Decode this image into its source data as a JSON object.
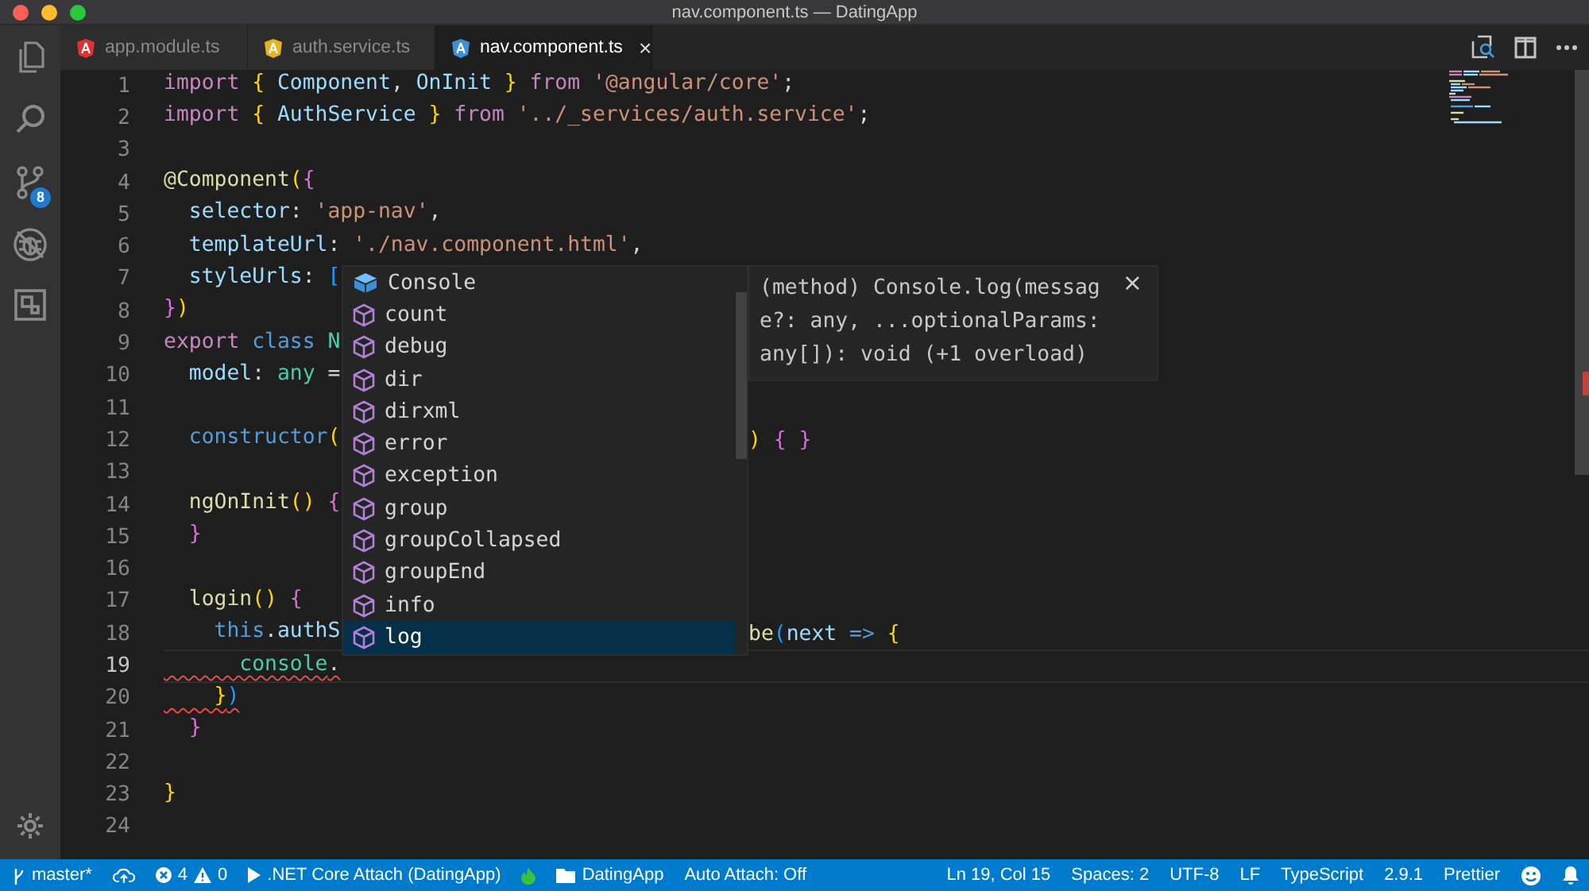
{
  "window": {
    "title": "nav.component.ts — DatingApp"
  },
  "activity_bar": {
    "source_control_badge": "8"
  },
  "tabs": [
    {
      "label": "app.module.ts",
      "color": "#dd3333",
      "selected": false
    },
    {
      "label": "auth.service.ts",
      "color": "#e8b320",
      "selected": false
    },
    {
      "label": "nav.component.ts",
      "color": "#3f8fd6",
      "selected": true,
      "close": "×"
    }
  ],
  "editor": {
    "lines": [
      {
        "number": "1",
        "current": false,
        "error": false,
        "tokens": [
          {
            "kind": "keyword",
            "text": "import "
          },
          {
            "kind": "bracket1",
            "text": "{ "
          },
          {
            "kind": "variable",
            "text": "Component"
          },
          {
            "kind": "plain",
            "text": ", "
          },
          {
            "kind": "variable",
            "text": "OnInit "
          },
          {
            "kind": "bracket1",
            "text": "} "
          },
          {
            "kind": "keyword",
            "text": "from "
          },
          {
            "kind": "string",
            "text": "'@angular/core'"
          },
          {
            "kind": "plain",
            "text": ";"
          }
        ]
      },
      {
        "number": "2",
        "current": false,
        "error": false,
        "tokens": [
          {
            "kind": "keyword",
            "text": "import "
          },
          {
            "kind": "bracket1",
            "text": "{ "
          },
          {
            "kind": "variable",
            "text": "AuthService "
          },
          {
            "kind": "bracket1",
            "text": "} "
          },
          {
            "kind": "keyword",
            "text": "from "
          },
          {
            "kind": "string",
            "text": "'../_services/auth.service'"
          },
          {
            "kind": "plain",
            "text": ";"
          }
        ]
      },
      {
        "number": "3",
        "current": false
      },
      {
        "number": "4",
        "current": false,
        "error": false,
        "tokens": [
          {
            "kind": "function",
            "text": "@Component"
          },
          {
            "kind": "bracket1",
            "text": "("
          },
          {
            "kind": "bracket2",
            "text": "{"
          }
        ]
      },
      {
        "number": "5",
        "current": false,
        "error": false,
        "tokens": [
          {
            "kind": "variable",
            "text": "  selector"
          },
          {
            "kind": "plain",
            "text": ": "
          },
          {
            "kind": "string",
            "text": "'app-nav'"
          },
          {
            "kind": "plain",
            "text": ","
          }
        ]
      },
      {
        "number": "6",
        "current": false,
        "error": false,
        "tokens": [
          {
            "kind": "variable",
            "text": "  templateUrl"
          },
          {
            "kind": "plain",
            "text": ": "
          },
          {
            "kind": "string",
            "text": "'./nav.component.html'"
          },
          {
            "kind": "plain",
            "text": ","
          }
        ]
      },
      {
        "number": "7",
        "current": false,
        "error": false,
        "tokens": [
          {
            "kind": "variable",
            "text": "  styleUrls"
          },
          {
            "kind": "plain",
            "text": ": "
          },
          {
            "kind": "bracket3",
            "text": "["
          }
        ]
      },
      {
        "number": "8",
        "current": false,
        "error": false,
        "tokens": [
          {
            "kind": "bracket2",
            "text": "}"
          },
          {
            "kind": "bracket1",
            "text": ")"
          }
        ]
      },
      {
        "number": "9",
        "current": false,
        "error": false,
        "tokens": [
          {
            "kind": "keyword",
            "text": "export "
          },
          {
            "kind": "storage",
            "text": "class "
          },
          {
            "kind": "type",
            "text": "N"
          }
        ]
      },
      {
        "number": "10",
        "current": false,
        "error": false,
        "tokens": [
          {
            "kind": "variable",
            "text": "  model"
          },
          {
            "kind": "plain",
            "text": ": "
          },
          {
            "kind": "type",
            "text": "any "
          },
          {
            "kind": "plain",
            "text": "="
          }
        ]
      },
      {
        "number": "11",
        "current": false
      },
      {
        "number": "12",
        "current": false,
        "error": false,
        "tokens": [
          {
            "kind": "storage",
            "text": "  constructor"
          },
          {
            "kind": "bracket1",
            "text": "("
          }
        ],
        "tokens_after": [
          {
            "kind": "bracket1",
            "text": ") "
          },
          {
            "kind": "bracket2",
            "text": "{ }"
          }
        ]
      },
      {
        "number": "13",
        "current": false
      },
      {
        "number": "14",
        "current": false,
        "error": false,
        "tokens": [
          {
            "kind": "function",
            "text": "  ngOnInit"
          },
          {
            "kind": "bracket1",
            "text": "() "
          },
          {
            "kind": "bracket2",
            "text": "{"
          }
        ]
      },
      {
        "number": "15",
        "current": false,
        "error": false,
        "tokens": [
          {
            "kind": "bracket2",
            "text": "  }"
          }
        ]
      },
      {
        "number": "16",
        "current": false
      },
      {
        "number": "17",
        "current": false,
        "error": false,
        "tokens": [
          {
            "kind": "function",
            "text": "  login"
          },
          {
            "kind": "bracket1",
            "text": "() "
          },
          {
            "kind": "bracket2",
            "text": "{"
          }
        ]
      },
      {
        "number": "18",
        "current": false,
        "error": false,
        "tokens": [
          {
            "kind": "storage",
            "text": "    this"
          },
          {
            "kind": "plain",
            "text": "."
          },
          {
            "kind": "variable",
            "text": "authS"
          }
        ],
        "tokens_after": [
          {
            "kind": "function",
            "text": "be"
          },
          {
            "kind": "bracket3",
            "text": "("
          },
          {
            "kind": "variable",
            "text": "next "
          },
          {
            "kind": "storage",
            "text": "=> "
          },
          {
            "kind": "bracket1",
            "text": "{"
          }
        ]
      },
      {
        "number": "19",
        "current": true,
        "error": true,
        "tokens": [
          {
            "kind": "type",
            "text": "      console"
          },
          {
            "kind": "plain",
            "text": "."
          }
        ]
      },
      {
        "number": "20",
        "current": false,
        "error": true,
        "tokens": [
          {
            "kind": "bracket1",
            "text": "    }"
          },
          {
            "kind": "bracket3",
            "text": ")"
          }
        ]
      },
      {
        "number": "21",
        "current": false,
        "error": false,
        "tokens": [
          {
            "kind": "bracket2",
            "text": "  }"
          }
        ]
      },
      {
        "number": "22",
        "current": false
      },
      {
        "number": "23",
        "current": false,
        "error": false,
        "tokens": [
          {
            "kind": "bracket1",
            "text": "}"
          }
        ]
      },
      {
        "number": "24",
        "current": false
      }
    ],
    "suggest": {
      "items": [
        {
          "label": "Console",
          "kind": "class",
          "selected": false
        },
        {
          "label": "count",
          "kind": "method",
          "selected": false
        },
        {
          "label": "debug",
          "kind": "method",
          "selected": false
        },
        {
          "label": "dir",
          "kind": "method",
          "selected": false
        },
        {
          "label": "dirxml",
          "kind": "method",
          "selected": false
        },
        {
          "label": "error",
          "kind": "method",
          "selected": false
        },
        {
          "label": "exception",
          "kind": "method",
          "selected": false
        },
        {
          "label": "group",
          "kind": "method",
          "selected": false
        },
        {
          "label": "groupCollapsed",
          "kind": "method",
          "selected": false
        },
        {
          "label": "groupEnd",
          "kind": "method",
          "selected": false
        },
        {
          "label": "info",
          "kind": "method",
          "selected": false
        },
        {
          "label": "log",
          "kind": "method",
          "selected": true
        }
      ],
      "details": "(method) Console.log(message?: any, ...optionalParams: any[]): void (+1 overload)",
      "close": "×"
    }
  },
  "status_bar": {
    "branch": "master*",
    "errors": "4",
    "warnings": "0",
    "debug": ".NET Core Attach (DatingApp)",
    "folder": "DatingApp",
    "auto_attach": "Auto Attach: Off",
    "position": "Ln 19, Col 15",
    "indent": "Spaces: 2",
    "encoding": "UTF-8",
    "eol": "LF",
    "language": "TypeScript",
    "version": "2.9.1",
    "formatter": "Prettier"
  }
}
